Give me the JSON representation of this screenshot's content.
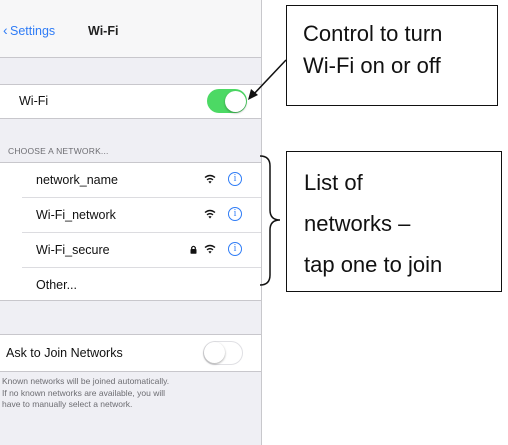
{
  "navbar": {
    "back_label": "Settings",
    "title": "Wi-Fi"
  },
  "wifi": {
    "label": "Wi-Fi",
    "enabled": true
  },
  "section_header": "CHOOSE A NETWORK...",
  "networks": [
    {
      "name": "network_name",
      "locked": false,
      "icons": [
        "wifi-icon",
        "info-icon"
      ]
    },
    {
      "name": "Wi-Fi_network",
      "locked": false,
      "icons": [
        "wifi-icon",
        "info-icon"
      ]
    },
    {
      "name": "Wi-Fi_secure",
      "locked": true,
      "icons": [
        "lock-icon",
        "wifi-icon",
        "info-icon"
      ]
    }
  ],
  "other_label": "Other...",
  "ask_to_join": {
    "label": "Ask to Join Networks",
    "enabled": false
  },
  "footer_lines": [
    "Known networks will be joined automatically.",
    "If no known networks are available, you will",
    "have to manually select a network."
  ],
  "callouts": {
    "toggle": [
      "Control to turn",
      "Wi-Fi on or off"
    ],
    "list": [
      "List of",
      "networks –",
      "tap one to join"
    ]
  },
  "colors": {
    "accent": "#2f7cf6",
    "toggle_on": "#4cd964",
    "background": "#efeff4"
  }
}
